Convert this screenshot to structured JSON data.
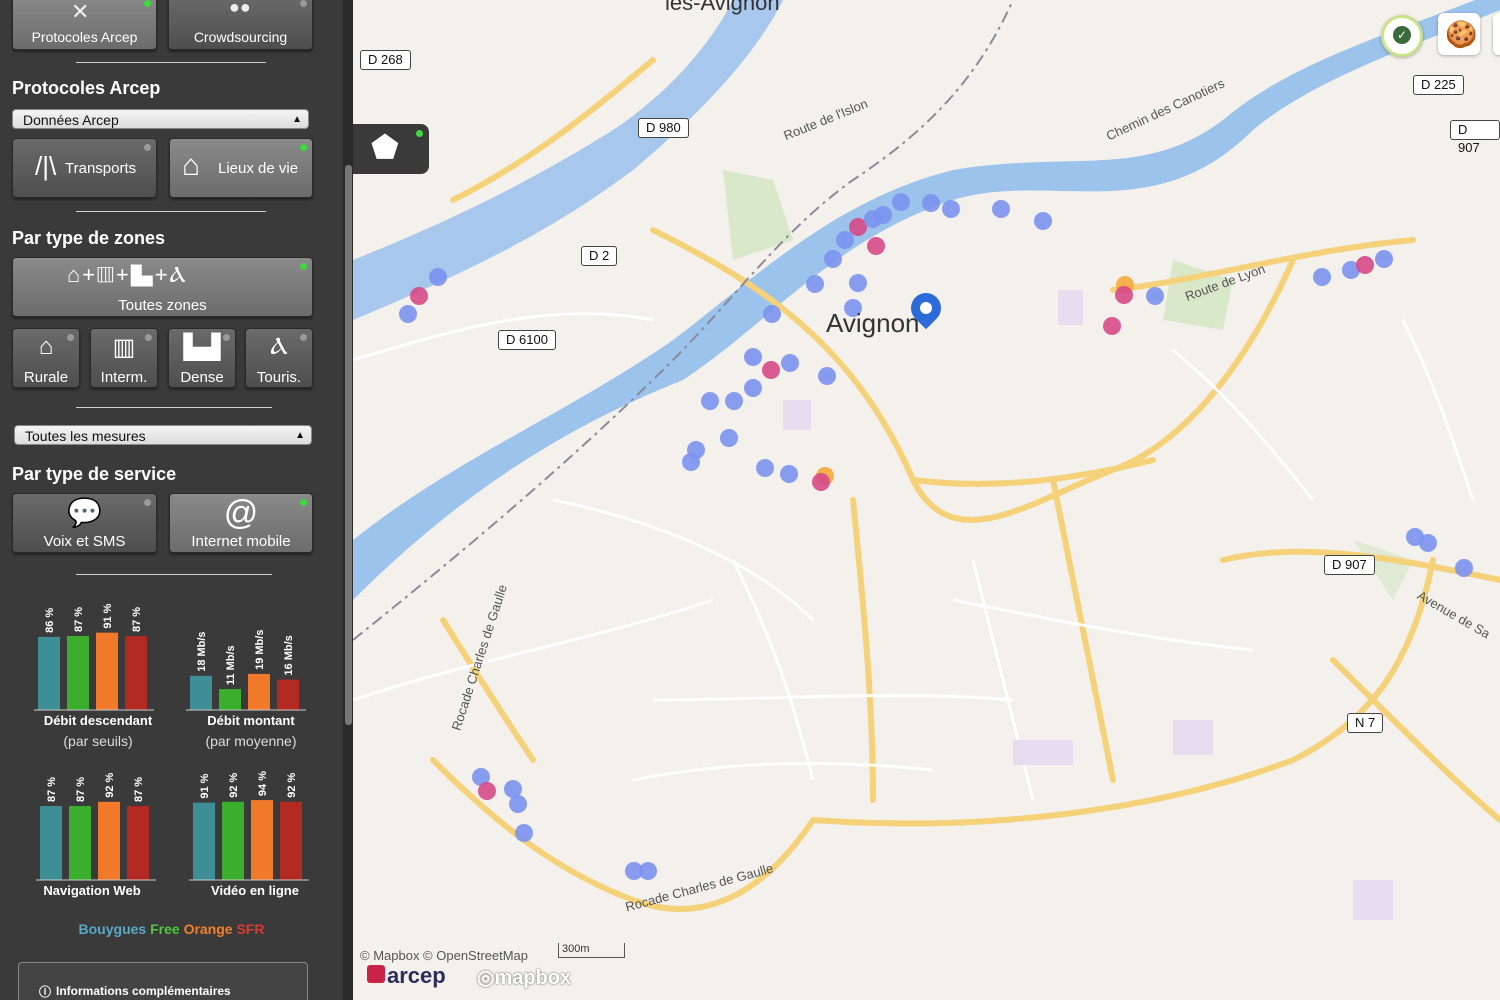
{
  "protocol_tabs": [
    {
      "label": "Protocoles Arcep",
      "active": true
    },
    {
      "label": "Crowdsourcing",
      "active": false
    }
  ],
  "sections": {
    "protocols": "Protocoles Arcep",
    "zones": "Par type de zones",
    "service": "Par type de service"
  },
  "data_select": {
    "value": "Données Arcep"
  },
  "measures_select": {
    "value": "Toutes les mesures"
  },
  "env_buttons": [
    {
      "label": "Transports",
      "active": false
    },
    {
      "label": "Lieux de vie",
      "active": true
    }
  ],
  "zones": {
    "all": {
      "label": "Toutes zones",
      "active": true
    },
    "items": [
      {
        "label": "Rurale"
      },
      {
        "label": "Interm."
      },
      {
        "label": "Dense"
      },
      {
        "label": "Touris."
      }
    ]
  },
  "services": [
    {
      "label": "Voix et SMS",
      "active": false
    },
    {
      "label": "Internet mobile",
      "active": true
    }
  ],
  "operators": [
    {
      "name": "Bouygues",
      "color": "#3d8e95"
    },
    {
      "name": "Free",
      "color": "#3cae2e"
    },
    {
      "name": "Orange",
      "color": "#f07a2a"
    },
    {
      "name": "SFR",
      "color": "#b32a23"
    }
  ],
  "charts": [
    {
      "title": "Débit descendant",
      "subtitle": "(par seuils)",
      "labels": [
        "86 %",
        "87 %",
        "91 %",
        "87 %"
      ],
      "values": [
        86,
        87,
        91,
        87
      ]
    },
    {
      "title": "Débit montant",
      "subtitle": "(par moyenne)",
      "labels": [
        "18 Mb/s",
        "11 Mb/s",
        "19 Mb/s",
        "16 Mb/s"
      ],
      "values": [
        18,
        11,
        19,
        16
      ]
    },
    {
      "title": "Navigation Web",
      "subtitle": "",
      "labels": [
        "87 %",
        "87 %",
        "92 %",
        "87 %"
      ],
      "values": [
        87,
        87,
        92,
        87
      ]
    },
    {
      "title": "Vidéo en ligne",
      "subtitle": "",
      "labels": [
        "91 %",
        "92 %",
        "94 %",
        "92 %"
      ],
      "values": [
        91,
        92,
        94,
        92
      ]
    }
  ],
  "info_label": "Informations complémentaires",
  "map": {
    "city": "Avignon",
    "city_top": "les-Avignon",
    "roads": [
      "D 268",
      "D 980",
      "D 2",
      "D 6100",
      "D 225",
      "D 907",
      "D 907",
      "N 7"
    ],
    "streets": [
      "Route de l'Islon",
      "Chemin des Canotiers",
      "Route de Lyon",
      "Rocade Charles de Gaulle",
      "Rocade Charles de Gaulle",
      "Avenue de Sa"
    ],
    "attribution": "© Mapbox © OpenStreetMap",
    "scale": "300m",
    "brand": "arcep",
    "mapbox": "mapbox"
  }
}
